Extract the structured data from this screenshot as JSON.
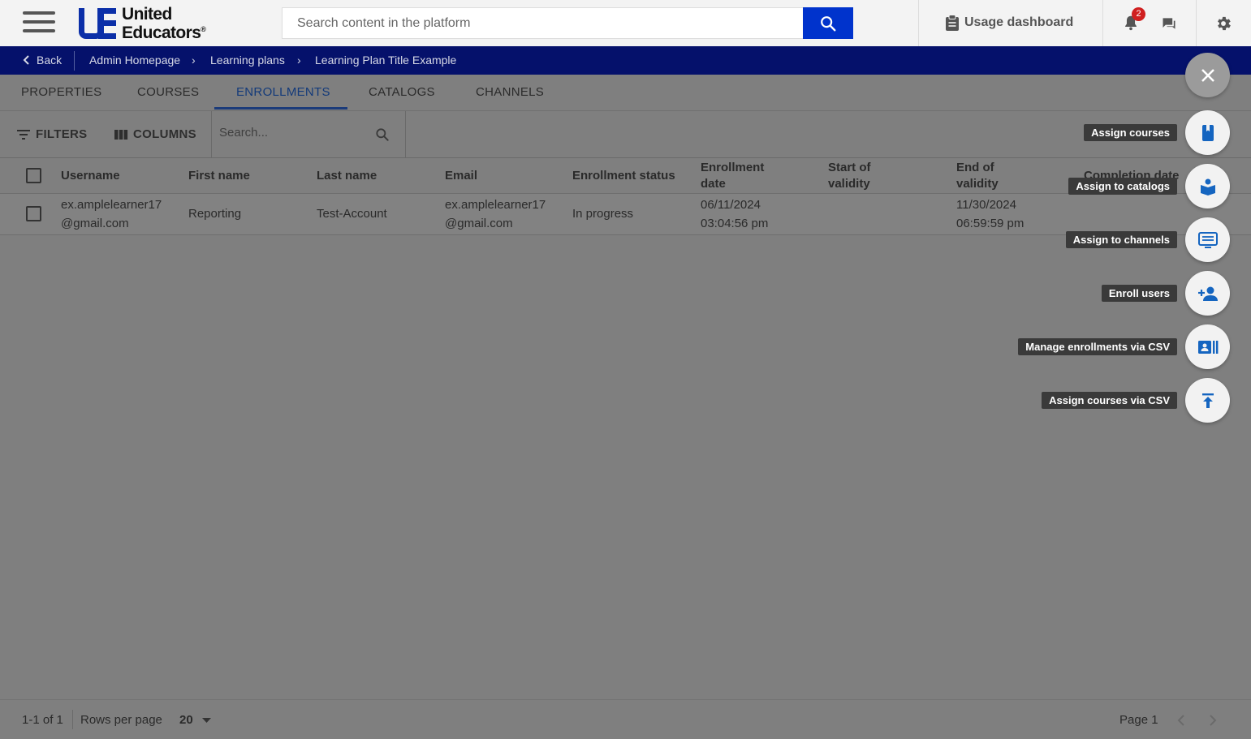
{
  "header": {
    "logo_line1": "United",
    "logo_line2": "Educators",
    "logo_mark": "®",
    "search_placeholder": "Search content in the platform",
    "usage_label": "Usage dashboard",
    "notification_count": "2"
  },
  "breadcrumb": {
    "back": "Back",
    "items": [
      "Admin Homepage",
      "Learning plans",
      "Learning Plan Title Example"
    ],
    "arrow": "›"
  },
  "tabs": [
    "PROPERTIES",
    "COURSES",
    "ENROLLMENTS",
    "CATALOGS",
    "CHANNELS"
  ],
  "active_tab": "ENROLLMENTS",
  "toolbar": {
    "filters": "FILTERS",
    "columns": "COLUMNS",
    "search_placeholder": "Search..."
  },
  "table": {
    "headers": {
      "username": "Username",
      "first_name": "First name",
      "last_name": "Last name",
      "email": "Email",
      "enrollment_status": "Enrollment status",
      "enrollment_date_1": "Enrollment",
      "enrollment_date_2": "date",
      "start_validity_1": "Start of",
      "start_validity_2": "validity",
      "end_validity_1": "End of",
      "end_validity_2": "validity",
      "completion_date": "Completion date"
    },
    "rows": [
      {
        "username_1": "ex.amplelearner17",
        "username_2": "@gmail.com",
        "first_name": "Reporting",
        "last_name": "Test-Account",
        "email_1": "ex.amplelearner17",
        "email_2": "@gmail.com",
        "status": "In progress",
        "enrollment_date_1": "06/11/2024",
        "enrollment_date_2": "03:04:56 pm",
        "end_validity_1": "11/30/2024",
        "end_validity_2": "06:59:59 pm"
      }
    ]
  },
  "footer": {
    "range": "1-1 of 1",
    "rows_per_page_label": "Rows per page",
    "rows_per_page_value": "20",
    "page": "Page 1"
  },
  "speed_dial": {
    "close_icon": "close-icon",
    "actions": [
      {
        "label": "Assign courses",
        "icon": "book-icon"
      },
      {
        "label": "Assign to catalogs",
        "icon": "catalog-icon"
      },
      {
        "label": "Assign to channels",
        "icon": "channel-icon"
      },
      {
        "label": "Enroll users",
        "icon": "add-person-icon"
      },
      {
        "label": "Manage enrollments via CSV",
        "icon": "csv-contact-icon"
      },
      {
        "label": "Assign courses via CSV",
        "icon": "upload-icon"
      }
    ]
  },
  "colors": {
    "accent_blue": "#0033cc",
    "breadcrumb_bg": "#05116b",
    "overlay_gray": "#7f7f7f",
    "badge_red": "#d01f1f",
    "fab_icon_blue": "#1565c0"
  }
}
